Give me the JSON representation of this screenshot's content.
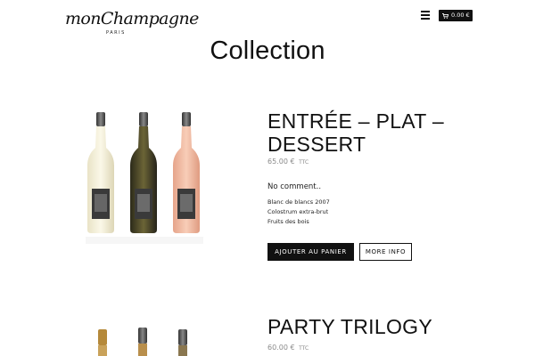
{
  "header": {
    "logo_text": "monChampagne",
    "logo_sub": "PARIS",
    "cart_total": "0.00 €"
  },
  "page_title": "Collection",
  "products": [
    {
      "title": "ENTRÉE – PLAT – DESSERT",
      "price": "65.00 €",
      "price_suffix": "TTC",
      "comment": "No comment..",
      "items": [
        "Blanc de blancs 2007",
        "Colostrum extra-brut",
        "Fruits des bois"
      ],
      "add_to_cart_label": "AJOUTER AU PANIER",
      "more_info_label": "MORE INFO"
    },
    {
      "title": "PARTY TRILOGY",
      "price": "60.00 €",
      "price_suffix": "TTC"
    }
  ],
  "icons": {
    "menu": "hamburger-icon",
    "cart": "cart-icon"
  },
  "colors": {
    "primary": "#111111",
    "price": "#8a8a8a",
    "background": "#ffffff"
  }
}
